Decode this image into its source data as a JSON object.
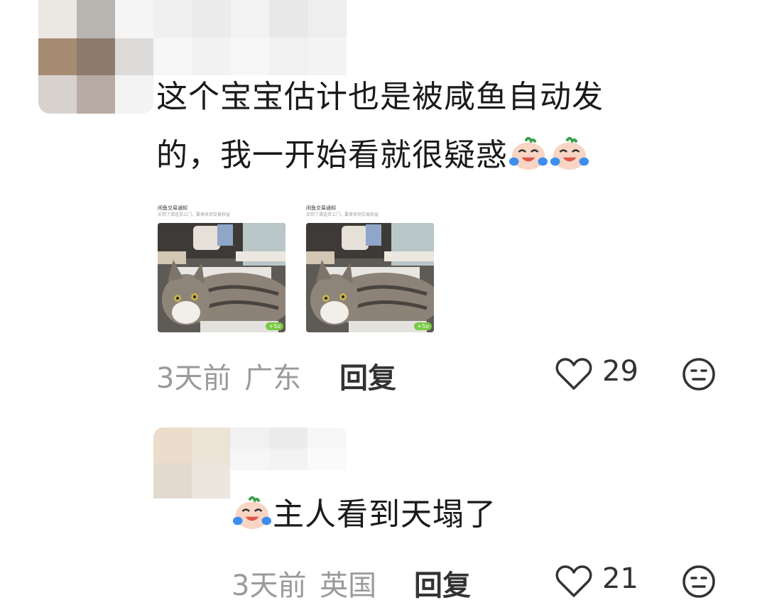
{
  "comments": [
    {
      "text_line1": "这个宝宝估计也是被咸鱼自动发",
      "text_line2": "的，我一开始看就很疑惑",
      "emoji": [
        "cry-laugh-emoji",
        "cry-laugh-emoji"
      ],
      "attachment": {
        "title": "闲鱼交易通知",
        "subtitle": "买到了请送货上门，要享收到交易权益",
        "badge": "+5o"
      },
      "time": "3天前",
      "location": "广东",
      "reply_label": "回复",
      "likes": "29"
    },
    {
      "text": "主人看到天塌了",
      "emoji": [
        "cry-laugh-emoji"
      ],
      "time": "3天前",
      "location": "英国",
      "reply_label": "回复",
      "likes": "21"
    }
  ],
  "icons": {
    "like": "heart-outline-icon",
    "dislike": "meh-face-icon"
  },
  "colors": {
    "text": "#1a1a1a",
    "meta": "#9a9a9a",
    "icon": "#333333"
  }
}
